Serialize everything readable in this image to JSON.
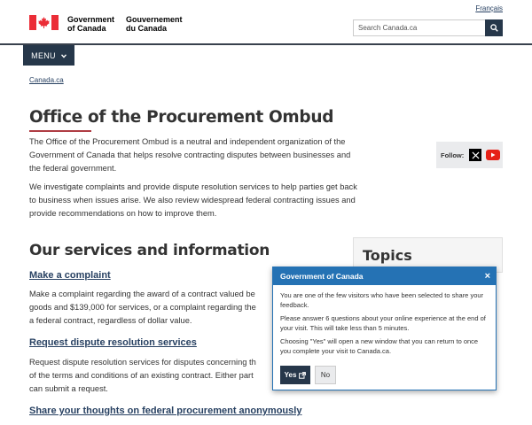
{
  "header": {
    "language_link": "Français",
    "signature_en_line1": "Government",
    "signature_en_line2": "of Canada",
    "signature_fr_line1": "Gouvernement",
    "signature_fr_line2": "du Canada",
    "search_placeholder": "Search Canada.ca",
    "menu_label": "MENU"
  },
  "breadcrumb": {
    "home": "Canada.ca"
  },
  "main": {
    "title": "Office of the Procurement Ombud",
    "intro_p1_l1": "The Office of the Procurement Ombud is a neutral and independent organization of the",
    "intro_p1_l2": "Government of Canada that helps resolve contracting disputes between businesses and",
    "intro_p1_l3": "the federal government.",
    "intro_p2_l1": "We investigate complaints and provide dispute resolution services to help parties get back",
    "intro_p2_l2": "to business when issues arise. We also review widespread federal contracting issues and",
    "intro_p2_l3": "provide recommendations on how to improve them.",
    "follow_label": "Follow:",
    "services_heading": "Our services and information",
    "services": [
      {
        "link": "Make a complaint",
        "lines": [
          "Make a complaint regarding the award of a contract valued be",
          "goods and $139,000 for services, or a complaint regarding the",
          "a federal contract, regardless of dollar value."
        ]
      },
      {
        "link": "Request dispute resolution services",
        "lines": [
          "Request dispute resolution services for disputes concerning th",
          "of the terms and conditions of an existing contract. Either part",
          "can submit a request."
        ]
      },
      {
        "link": "Share your thoughts on federal procurement anonymously",
        "lines": []
      }
    ],
    "topics_heading": "Topics"
  },
  "modal": {
    "title": "Government of Canada",
    "close_glyph": "×",
    "p1": "You are one of the few visitors who have been selected to share your feedback.",
    "p2": "Please answer 6 questions about your online experience at the end of your visit. This will take less than 5 minutes.",
    "p3": "Choosing \"Yes\" will open a new window that you can return to once you complete your visit to Canada.ca.",
    "yes_label": "Yes",
    "no_label": "No"
  },
  "colors": {
    "primary_dark": "#26374a",
    "link": "#284162",
    "accent_red": "#af3c43",
    "modal_blue": "#2572b4",
    "flag_red": "#eb2d37"
  },
  "icons": [
    "canada-flag-icon",
    "search-icon",
    "chevron-down-icon",
    "x-social-icon",
    "youtube-icon",
    "close-icon",
    "external-window-icon"
  ]
}
